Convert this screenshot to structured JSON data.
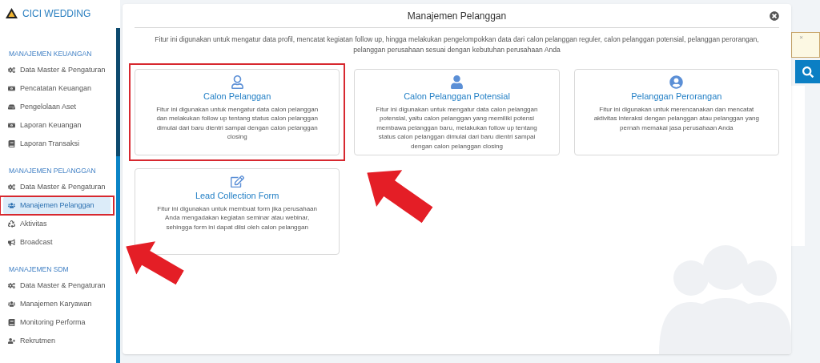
{
  "brand": {
    "name": "CICI WEDDING"
  },
  "sidebar": {
    "sections": [
      {
        "title": "MANAJEMEN KEUANGAN",
        "items": [
          {
            "label": "Data Master & Pengaturan",
            "kind": "cogs",
            "selected": false,
            "highlighted": false
          },
          {
            "label": "Pencatatan Keuangan",
            "kind": "money",
            "selected": false,
            "highlighted": false
          },
          {
            "label": "Pengelolaan Aset",
            "kind": "drive",
            "selected": false,
            "highlighted": false
          },
          {
            "label": "Laporan Keuangan",
            "kind": "money",
            "selected": false,
            "highlighted": false
          },
          {
            "label": "Laporan Transaksi",
            "kind": "book",
            "selected": false,
            "highlighted": false
          }
        ]
      },
      {
        "title": "MANAJEMEN PELANGGAN",
        "items": [
          {
            "label": "Data Master & Pengaturan",
            "kind": "cogs",
            "selected": false,
            "highlighted": false
          },
          {
            "label": "Manajemen Pelanggan",
            "kind": "users",
            "selected": true,
            "highlighted": true
          },
          {
            "label": "Aktivitas",
            "kind": "recycle",
            "selected": false,
            "highlighted": false
          },
          {
            "label": "Broadcast",
            "kind": "bullhorn",
            "selected": false,
            "highlighted": false
          }
        ]
      },
      {
        "title": "MANAJEMEN SDM",
        "items": [
          {
            "label": "Data Master & Pengaturan",
            "kind": "cogs",
            "selected": false,
            "highlighted": false
          },
          {
            "label": "Manajemen Karyawan",
            "kind": "users",
            "selected": false,
            "highlighted": false
          },
          {
            "label": "Monitoring Performa",
            "kind": "book",
            "selected": false,
            "highlighted": false
          },
          {
            "label": "Rekrutmen",
            "kind": "userplus",
            "selected": false,
            "highlighted": false
          }
        ]
      }
    ]
  },
  "alert": {
    "close": "×"
  },
  "modal": {
    "title": "Manajemen Pelanggan",
    "description": "Fitur ini digunakan untuk mengatur data profil, mencatat kegiatan follow up, hingga melakukan pengelompokkan data dari calon pelanggan reguler, calon pelanggan potensial, pelanggan perorangan, pelanggan perusahaan sesuai dengan kebutuhan perusahaan Anda",
    "cards": [
      {
        "kind": "user-outline",
        "title": "Calon Pelanggan",
        "text": "Fitur ini digunakan untuk mengatur data calon pelanggan dan melakukan follow up tentang status calon pelanggan dimulai dari baru dientri sampai dengan calon pelanggan closing",
        "highlighted": true
      },
      {
        "kind": "user-solid",
        "title": "Calon Pelanggan Potensial",
        "text": "Fitur ini digunakan untuk mengatur data calon pelanggan potensial, yaitu calon pelanggan yang memiliki potensi membawa pelanggan baru, melakukan follow up tentang status calon pelanggan dimulai dari baru dientri sampai dengan calon pelanggan closing",
        "highlighted": false
      },
      {
        "kind": "user-circle",
        "title": "Pelanggan Perorangan",
        "text": "Fitur ini digunakan untuk merencanakan dan mencatat aktivitas interaksi dengan pelanggan atau pelanggan yang pernah memakai jasa perusahaan Anda",
        "highlighted": false
      },
      {
        "kind": "edit",
        "title": "Lead Collection Form",
        "text": "Fitur ini digunakan untuk membuat form jika perusahaan Anda mengadakan kegiatan seminar atau webinar, sehingga form ini dapat diisi oleh calon pelanggan",
        "highlighted": false
      }
    ]
  }
}
